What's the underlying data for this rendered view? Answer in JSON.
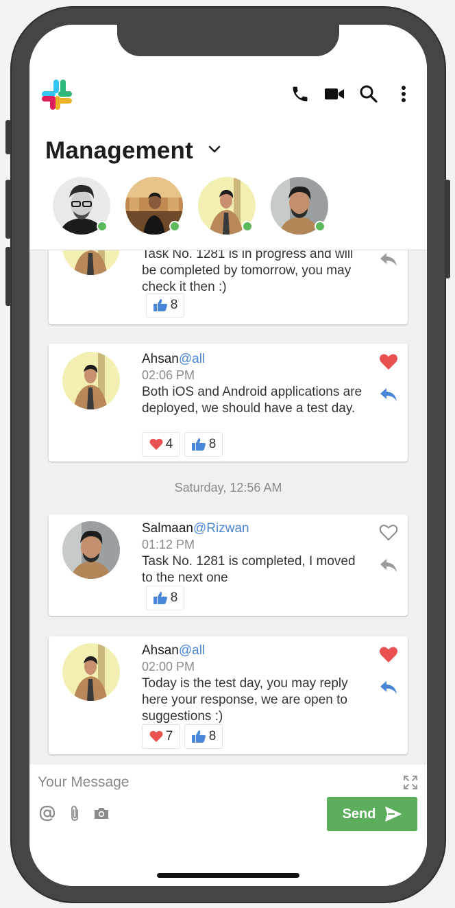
{
  "channel": {
    "title": "Management"
  },
  "header_icons": [
    "phone-icon",
    "video-icon",
    "search-icon",
    "more-vertical-icon"
  ],
  "members": [
    {
      "avatar": "avatar-1",
      "status": "online"
    },
    {
      "avatar": "avatar-2",
      "status": "online"
    },
    {
      "avatar": "avatar-3",
      "status": "online"
    },
    {
      "avatar": "avatar-4",
      "status": "online"
    }
  ],
  "messages": [
    {
      "text": "Task No. 1281 is in progress and will be completed by tomorrow, you may check it then :)",
      "likes": "8",
      "liked": false
    },
    {
      "author": "Ahsan",
      "mention": "@all",
      "time": "02:06 PM",
      "text": "Both iOS and Android applications are deployed, we should have a test day.",
      "hearts": "4",
      "likes": "8",
      "liked": true
    },
    {
      "author": "Salmaan",
      "mention": "@Rizwan",
      "time": "01:12 PM",
      "text": "Task No. 1281 is completed, I moved to the next one",
      "likes": "8",
      "liked": false
    },
    {
      "author": "Ahsan",
      "mention": "@all",
      "time": "02:00 PM",
      "text": "Today is the test day, you may reply here your response, we are open to suggestions :)",
      "hearts": "7",
      "likes": "8",
      "liked": true
    }
  ],
  "date_separator": "Saturday, 12:56 AM",
  "composer": {
    "placeholder": "Your Message",
    "send_label": "Send"
  },
  "colors": {
    "accent_blue": "#4a86d8",
    "heart_red": "#e8514f",
    "send_green": "#5cad5c",
    "online_green": "#5cb85c"
  }
}
